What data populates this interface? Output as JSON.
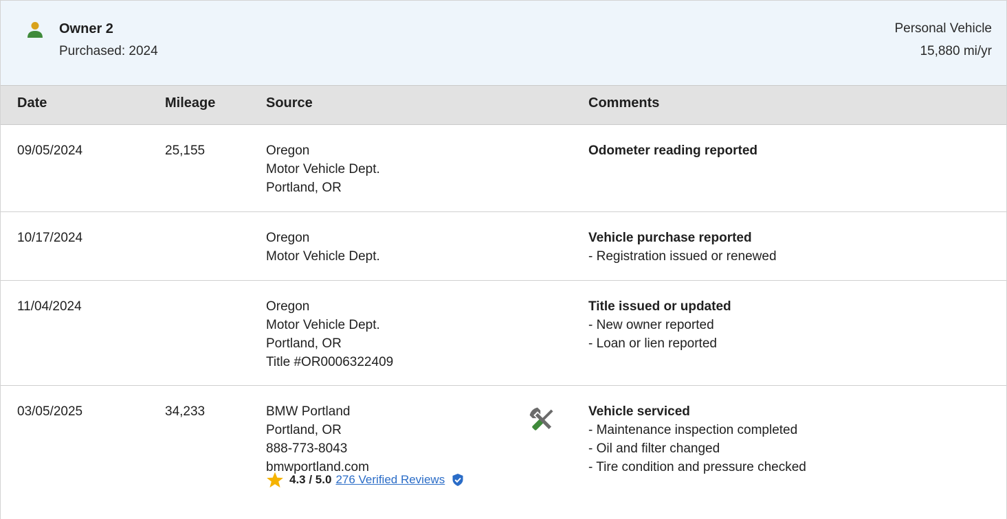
{
  "owner": {
    "name": "Owner 2",
    "purchased": "Purchased: 2024",
    "vehicle_type": "Personal Vehicle",
    "miles_per_year": "15,880 mi/yr",
    "icon": "person-icon"
  },
  "table": {
    "headers": {
      "date": "Date",
      "mileage": "Mileage",
      "source": "Source",
      "comments": "Comments"
    },
    "rows": [
      {
        "date": "09/05/2024",
        "mileage": "25,155",
        "source": [
          "Oregon",
          "Motor Vehicle Dept.",
          "Portland, OR"
        ],
        "comment_title": "Odometer reading reported",
        "comment_lines": []
      },
      {
        "date": "10/17/2024",
        "mileage": "",
        "source": [
          "Oregon",
          "Motor Vehicle Dept."
        ],
        "comment_title": "Vehicle purchase reported",
        "comment_lines": [
          "- Registration issued or renewed"
        ]
      },
      {
        "date": "11/04/2024",
        "mileage": "",
        "source": [
          "Oregon",
          "Motor Vehicle Dept.",
          "Portland, OR",
          "Title #OR0006322409"
        ],
        "comment_title": "Title issued or updated",
        "comment_lines": [
          "- New owner reported",
          "- Loan or lien reported"
        ]
      },
      {
        "date": "03/05/2025",
        "mileage": "34,233",
        "source": [
          "BMW Portland",
          "Portland, OR",
          "888-773-8043",
          "bmwportland.com"
        ],
        "icon": "service-tools-icon",
        "comment_title": "Vehicle serviced",
        "comment_lines": [
          "- Maintenance inspection completed",
          "- Oil and filter changed",
          "- Tire condition and pressure checked"
        ],
        "rating": {
          "value": "4.3 / 5.0",
          "reviews": "276 Verified Reviews",
          "icon": "star-icon",
          "verified_icon": "shield-check-icon"
        }
      }
    ]
  },
  "colors": {
    "header_bg": "#eef5fb",
    "table_head_bg": "#e2e2e2",
    "link": "#2a6cc7",
    "person_head": "#d9a21b",
    "person_body": "#3f8a3a",
    "star": "#f5b301",
    "tools_green": "#3f8a3a",
    "tools_grey": "#6b6b6b"
  }
}
